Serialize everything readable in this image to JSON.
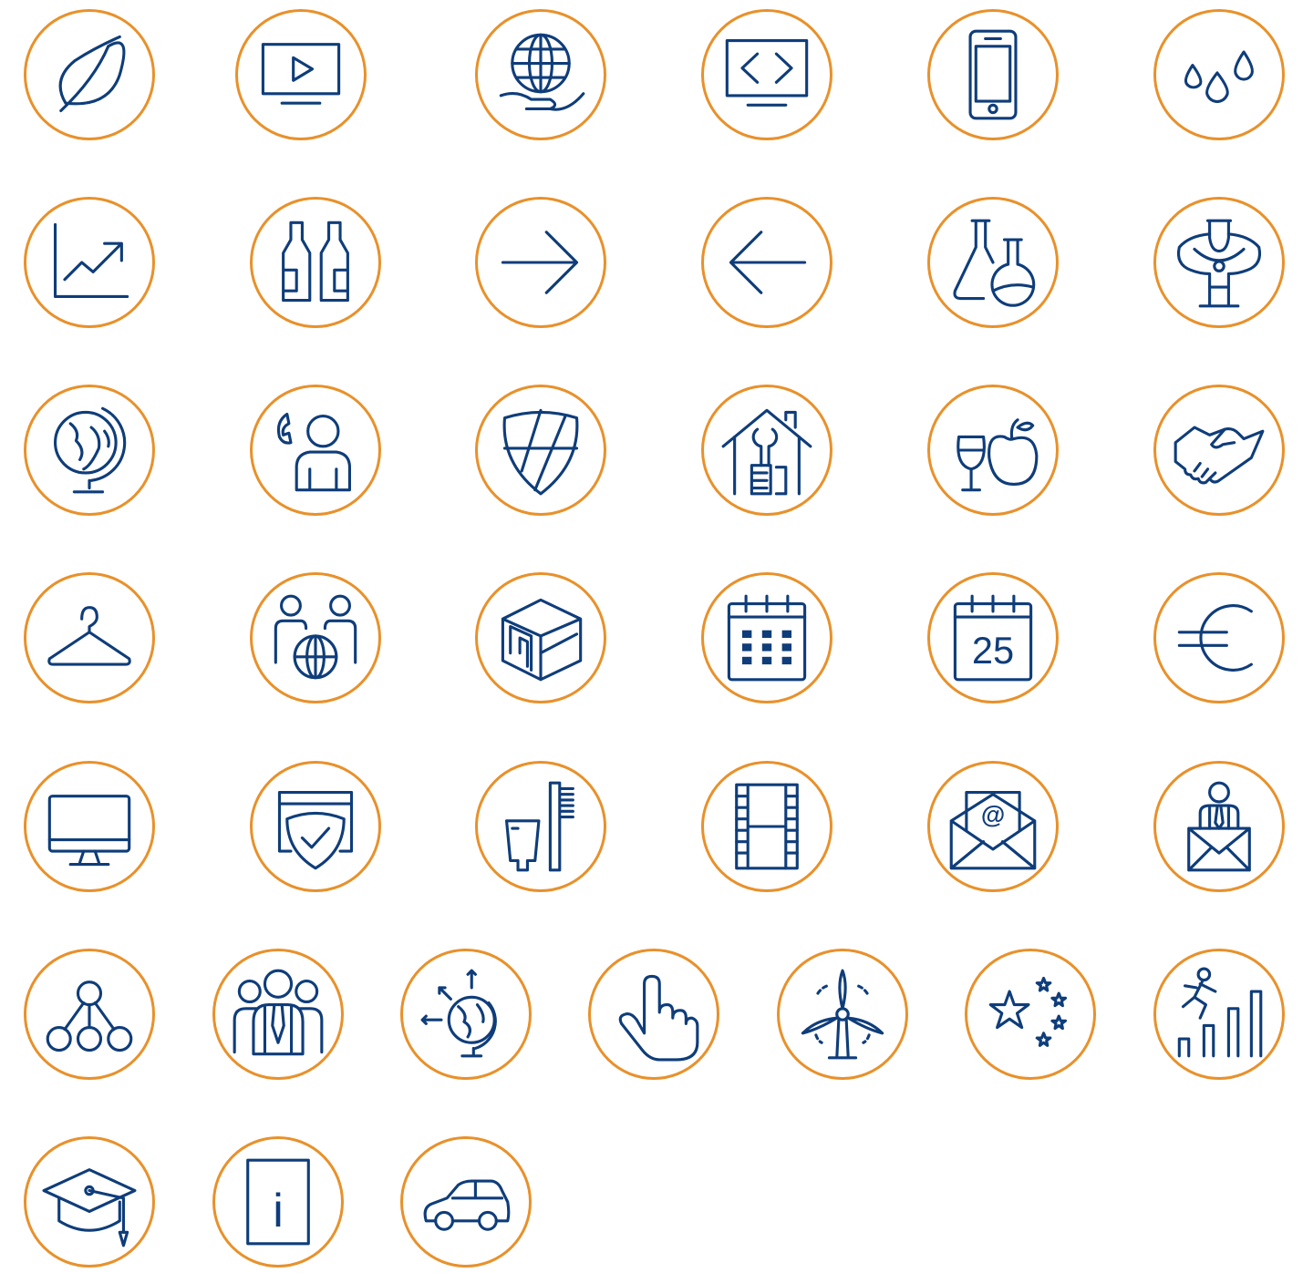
{
  "theme": {
    "ring_color": "#E8912B",
    "icon_color": "#0F3D7A",
    "background": "#FFFFFF"
  },
  "icons": [
    {
      "name": "leaf-icon"
    },
    {
      "name": "video-screen-icon"
    },
    {
      "name": "globe-in-hand-icon"
    },
    {
      "name": "code-monitor-icon"
    },
    {
      "name": "smartphone-icon"
    },
    {
      "name": "water-drops-icon"
    },
    {
      "name": "growth-chart-icon"
    },
    {
      "name": "bottles-icon"
    },
    {
      "name": "arrow-right-icon"
    },
    {
      "name": "arrow-left-icon"
    },
    {
      "name": "lab-flasks-icon"
    },
    {
      "name": "necklace-bust-icon"
    },
    {
      "name": "globe-stand-icon"
    },
    {
      "name": "customer-service-icon"
    },
    {
      "name": "shield-icon"
    },
    {
      "name": "home-repair-icon"
    },
    {
      "name": "wine-and-apple-icon"
    },
    {
      "name": "handshake-icon"
    },
    {
      "name": "clothes-hanger-icon"
    },
    {
      "name": "international-people-icon"
    },
    {
      "name": "cube-icon"
    },
    {
      "name": "calendar-icon"
    },
    {
      "name": "calendar-date-icon",
      "label": "25"
    },
    {
      "name": "euro-icon"
    },
    {
      "name": "desktop-monitor-icon"
    },
    {
      "name": "secure-browser-icon"
    },
    {
      "name": "toothpaste-toothbrush-icon"
    },
    {
      "name": "film-strip-icon"
    },
    {
      "name": "email-envelope-icon",
      "label": "@"
    },
    {
      "name": "person-with-mail-icon"
    },
    {
      "name": "network-nodes-icon"
    },
    {
      "name": "team-icon"
    },
    {
      "name": "global-expansion-icon"
    },
    {
      "name": "touch-hand-icon"
    },
    {
      "name": "wind-turbine-icon"
    },
    {
      "name": "china-flag-stars-icon"
    },
    {
      "name": "career-climb-icon"
    },
    {
      "name": "graduation-cap-icon"
    },
    {
      "name": "info-icon",
      "label": "i"
    },
    {
      "name": "car-icon"
    }
  ]
}
